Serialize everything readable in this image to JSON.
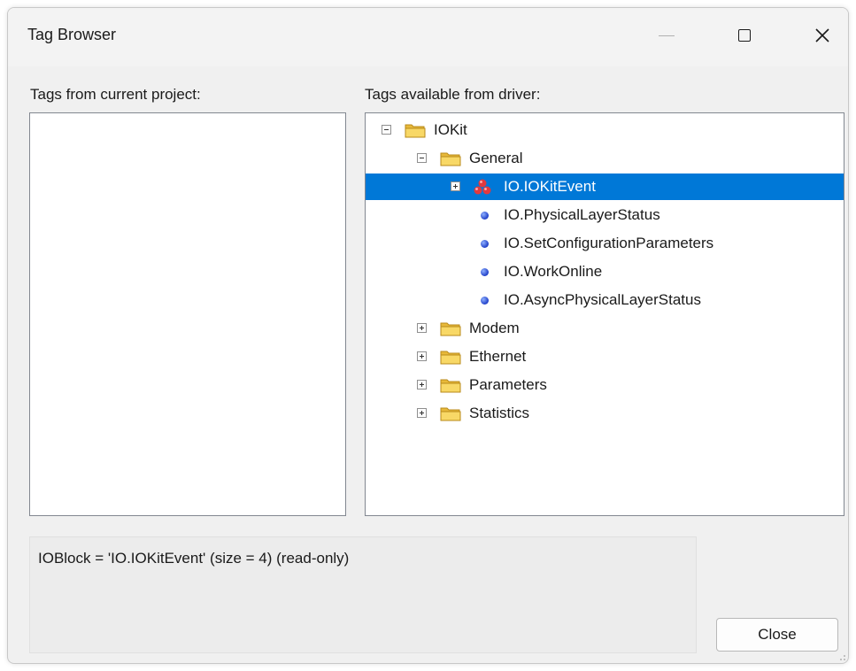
{
  "window": {
    "title": "Tag Browser"
  },
  "left_panel": {
    "label": "Tags from current project:"
  },
  "right_panel": {
    "label": "Tags available from driver:",
    "tree": [
      {
        "label": "IOKit",
        "type": "folder",
        "expanded": true
      },
      {
        "label": "General",
        "type": "folder",
        "expanded": true
      },
      {
        "label": "IO.IOKitEvent",
        "type": "ioblock",
        "expanded": false,
        "selected": true
      },
      {
        "label": "IO.PhysicalLayerStatus",
        "type": "tag"
      },
      {
        "label": "IO.SetConfigurationParameters",
        "type": "tag"
      },
      {
        "label": "IO.WorkOnline",
        "type": "tag"
      },
      {
        "label": "IO.AsyncPhysicalLayerStatus",
        "type": "tag"
      },
      {
        "label": "Modem",
        "type": "folder",
        "expanded": false
      },
      {
        "label": "Ethernet",
        "type": "folder",
        "expanded": false
      },
      {
        "label": "Parameters",
        "type": "folder",
        "expanded": false
      },
      {
        "label": "Statistics",
        "type": "folder",
        "expanded": false
      }
    ]
  },
  "status": {
    "text": "IOBlock = 'IO.IOKitEvent' (size = 4) (read-only)"
  },
  "buttons": {
    "close_label": "Close"
  },
  "colors": {
    "selection": "#0078d7",
    "folder": "#f5c542",
    "tag_dot": "#2a4fd8",
    "ioblock": "#e0393e"
  }
}
